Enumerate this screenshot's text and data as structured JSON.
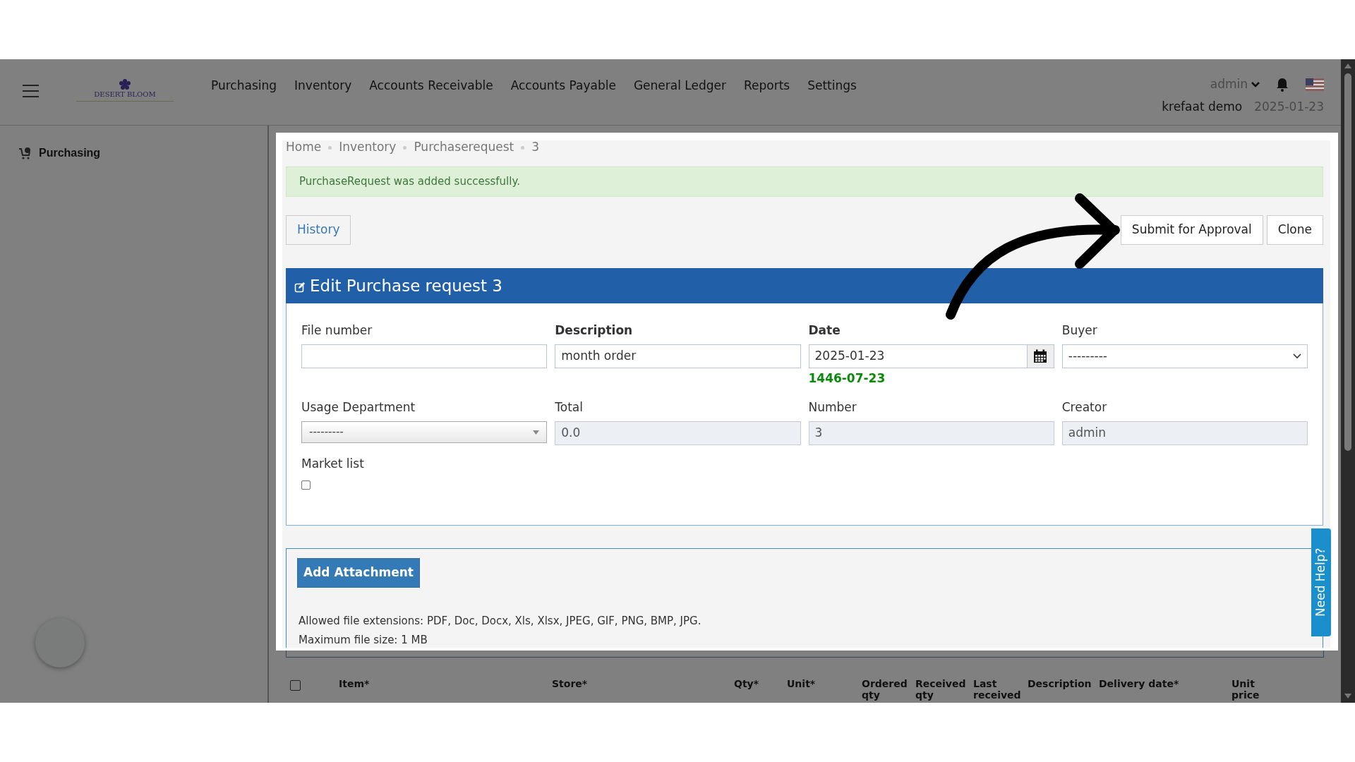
{
  "header": {
    "logo_text": "DESERT BLOOM",
    "nav": [
      "Purchasing",
      "Inventory",
      "Accounts Receivable",
      "Accounts Payable",
      "General Ledger",
      "Reports",
      "Settings"
    ],
    "user": "admin",
    "account": "krefaat demo",
    "date": "2025-01-23"
  },
  "sidebar": {
    "items": [
      {
        "label": "Purchasing"
      }
    ]
  },
  "breadcrumb": [
    "Home",
    "Inventory",
    "Purchaserequest",
    "3"
  ],
  "alert": "PurchaseRequest was added successfully.",
  "actions": {
    "left": [
      "History"
    ],
    "right": [
      "Submit for Approval",
      "Clone"
    ]
  },
  "form": {
    "title": "Edit Purchase request 3",
    "fields": [
      {
        "label": "File number",
        "kind": "text",
        "required": false
      },
      {
        "label": "Description",
        "kind": "text",
        "required": true,
        "value": "month order"
      },
      {
        "label": "Date",
        "kind": "date",
        "required": true,
        "value": "2025-01-23",
        "note": "1446-07-23"
      },
      {
        "label": "Buyer",
        "kind": "select",
        "required": false,
        "value": "---------"
      },
      {
        "label": "Usage Department",
        "kind": "combo",
        "required": false,
        "value": "---------"
      },
      {
        "label": "Total",
        "kind": "readonly",
        "required": false,
        "value": "0.0"
      },
      {
        "label": "Number",
        "kind": "readonly",
        "required": false,
        "value": "3"
      },
      {
        "label": "Creator",
        "kind": "readonly",
        "required": false,
        "value": "admin"
      },
      {
        "label": "Market list",
        "kind": "checkbox",
        "required": false,
        "checked": false
      }
    ]
  },
  "attachments": {
    "button": "Add Attachment",
    "lines": [
      "Allowed file extensions: PDF, Doc, Docx, Xls, Xlsx, JPEG, GIF, PNG, BMP, JPG.",
      "Maximum file size: 1 MB"
    ]
  },
  "help_tab": "Need Help?",
  "table": {
    "select_all_checked": false,
    "columns": [
      {
        "label": "Item*"
      },
      {
        "label": "Store*"
      },
      {
        "label": "Qty*"
      },
      {
        "label": "Unit*"
      },
      {
        "label": "Ordered qty"
      },
      {
        "label": "Received qty"
      },
      {
        "label": "Last received"
      },
      {
        "label": "Description"
      },
      {
        "label": "Delivery date*"
      },
      {
        "label": "Unit price"
      }
    ]
  }
}
